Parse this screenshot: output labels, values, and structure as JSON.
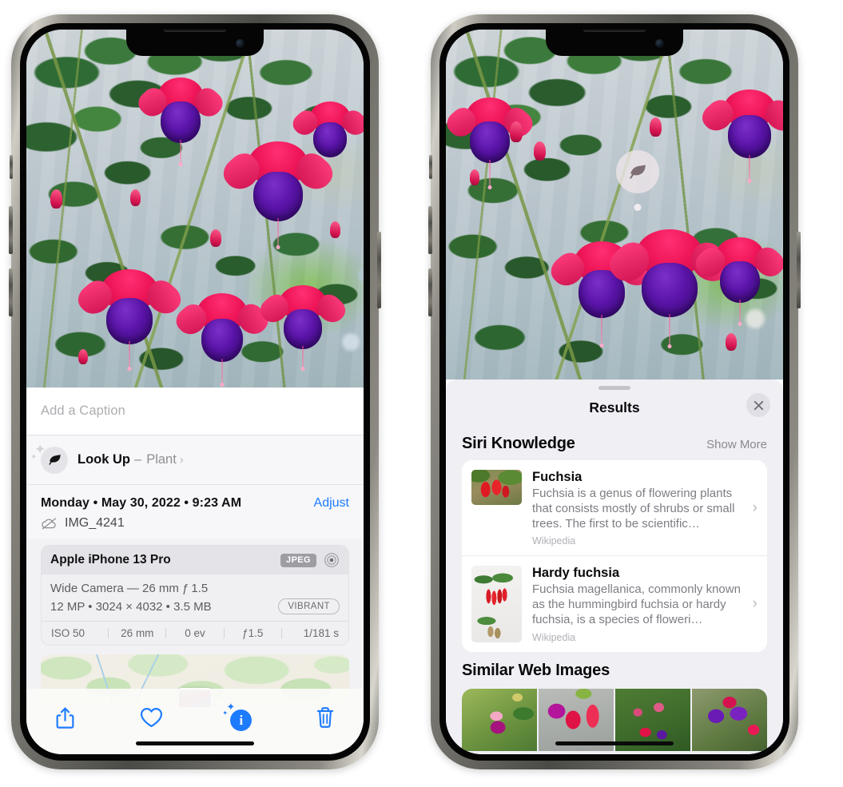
{
  "left_phone": {
    "photo": {
      "alt": "fuchsia-flowers-photo"
    },
    "caption": {
      "placeholder": "Add a Caption",
      "value": ""
    },
    "lookup": {
      "icon": "leaf-icon",
      "sparkle_icon": "sparkles-icon",
      "title": "Look Up",
      "dash": " – ",
      "subject": "Plant",
      "chevron": "›"
    },
    "datetime": {
      "text": "Monday • May 30, 2022 • 9:23 AM",
      "adjust_label": "Adjust",
      "filename": "IMG_4241",
      "cloud_icon": "icloud-slash-icon"
    },
    "camera_card": {
      "model": "Apple iPhone 13 Pro",
      "format_badge": "JPEG",
      "aperture_icon": "aperture-icon",
      "lens": "Wide Camera — 26 mm ƒ 1.5",
      "meta": "12 MP • 3024 × 4032 • 3.5 MB",
      "style_pill": "VIBRANT",
      "exif": [
        "ISO 50",
        "26 mm",
        "0 ev",
        "ƒ1.5",
        "1/181 s"
      ]
    },
    "map": {
      "pin_label": "photo-location-pin"
    },
    "toolbar": [
      {
        "name": "share-button",
        "icon": "share-icon"
      },
      {
        "name": "favorite-button",
        "icon": "heart-icon"
      },
      {
        "name": "info-button",
        "icon": "info-sparkle-icon",
        "glyph": "i"
      },
      {
        "name": "delete-button",
        "icon": "trash-icon"
      }
    ]
  },
  "right_phone": {
    "photo": {
      "alt": "fuchsia-flowers-photo"
    },
    "leaf_badge": {
      "icon": "leaf-icon"
    },
    "sheet": {
      "title": "Results",
      "close_icon": "close-icon",
      "siri_knowledge": {
        "heading": "Siri Knowledge",
        "show_more": "Show More",
        "cards": [
          {
            "title": "Fuchsia",
            "description": "Fuchsia is a genus of flowering plants that consists mostly of shrubs or small trees. The first to be scientific…",
            "source": "Wikipedia",
            "thumb": "red-fuchsia-thumbnail",
            "chevron": "›"
          },
          {
            "title": "Hardy fuchsia",
            "description": "Fuchsia magellanica, commonly known as the hummingbird fuchsia or hardy fuchsia, is a species of floweri…",
            "source": "Wikipedia",
            "thumb": "hardy-fuchsia-specimen-thumbnail",
            "chevron": "›"
          }
        ]
      },
      "similar_web_images": {
        "heading": "Similar Web Images",
        "thumbs": [
          "fuchsia-web-image-1",
          "fuchsia-web-image-2",
          "fuchsia-web-image-3",
          "fuchsia-web-image-4"
        ]
      }
    }
  },
  "colors": {
    "accent_blue": "#1d7bff",
    "sheet_bg": "#f2f2f5",
    "results_bg": "#f0eff4",
    "card_bg": "#ffffff",
    "secondary_text": "#8e8e93"
  }
}
